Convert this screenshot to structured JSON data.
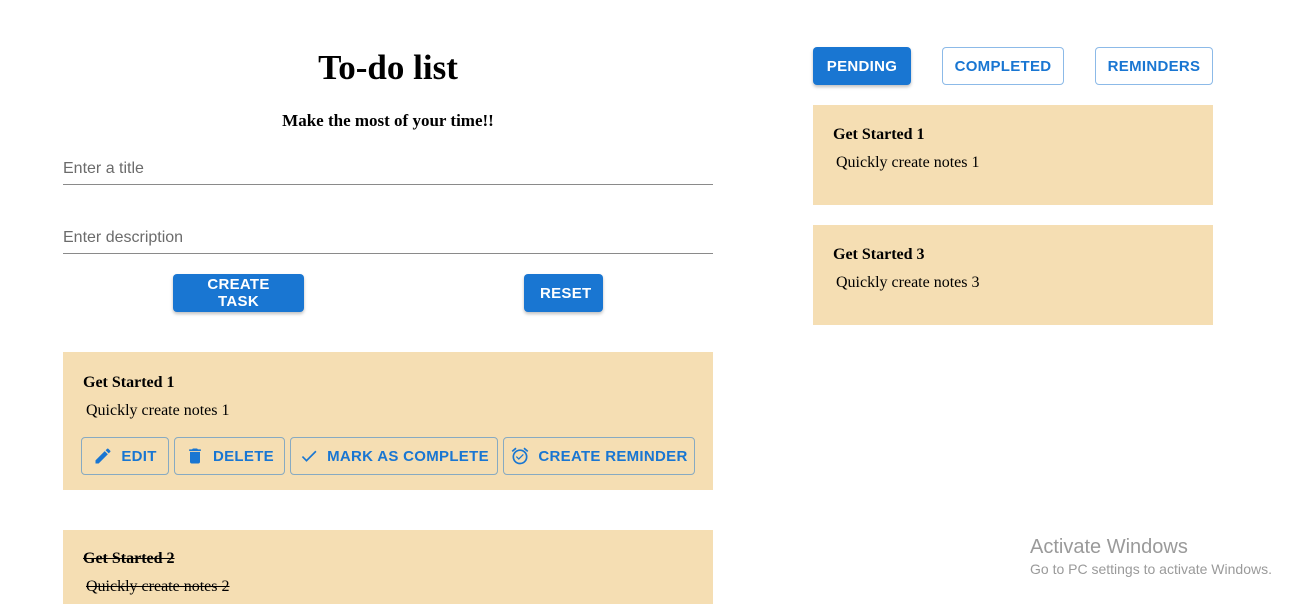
{
  "header": {
    "title": "To-do list",
    "subtitle": "Make the most of your time!!"
  },
  "form": {
    "title_placeholder": "Enter a title",
    "title_value": "",
    "description_placeholder": "Enter description",
    "description_value": "",
    "create_label": "CREATE TASK",
    "reset_label": "RESET"
  },
  "task_list": [
    {
      "title": "Get Started 1",
      "description": "Quickly create notes 1",
      "completed": false,
      "actions": {
        "edit": "EDIT",
        "delete": "DELETE",
        "complete": "MARK AS COMPLETE",
        "reminder": "CREATE REMINDER"
      }
    },
    {
      "title": "Get Started 2",
      "description": "Quickly create notes 2",
      "completed": true
    }
  ],
  "tabs": {
    "pending": "PENDING",
    "completed": "COMPLETED",
    "reminders": "REMINDERS",
    "active": "PENDING"
  },
  "pending_items": [
    {
      "title": "Get Started 1",
      "description": "Quickly create notes 1"
    },
    {
      "title": "Get Started 3",
      "description": "Quickly create notes 3"
    }
  ],
  "watermark": {
    "title": "Activate Windows",
    "subtitle": "Go to PC settings to activate Windows."
  },
  "colors": {
    "accent": "#1976d2",
    "card_background": "#f5deb3"
  },
  "icons": {
    "edit": "pencil-icon",
    "delete": "trash-icon",
    "complete": "checkmark-icon",
    "reminder": "alarm-clock-icon"
  }
}
